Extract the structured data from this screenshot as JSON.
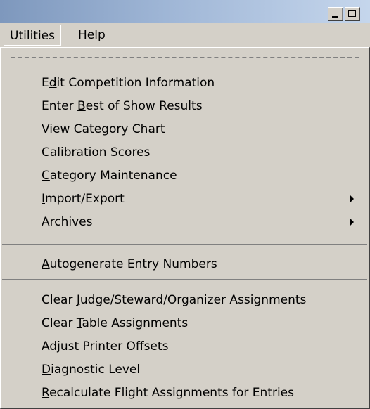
{
  "menubar": {
    "items": [
      {
        "label": "Utilities",
        "accel_index": 0
      },
      {
        "label": "Help",
        "accel_index": 0
      }
    ]
  },
  "menu": {
    "groups": [
      [
        {
          "label": "Edit Competition Information",
          "accel_index": 1,
          "submenu": false
        },
        {
          "label": "Enter Best of Show Results",
          "accel_index": 6,
          "submenu": false
        },
        {
          "label": "View Category Chart",
          "accel_index": 0,
          "submenu": false
        },
        {
          "label": "Calibration Scores",
          "accel_index": 3,
          "submenu": false
        },
        {
          "label": "Category Maintenance",
          "accel_index": 0,
          "submenu": false
        },
        {
          "label": "Import/Export",
          "accel_index": 0,
          "submenu": true
        },
        {
          "label": "Archives",
          "accel_index": -1,
          "submenu": true
        }
      ],
      [
        {
          "label": "Autogenerate Entry Numbers",
          "accel_index": 0,
          "submenu": false
        }
      ],
      [
        {
          "label": "Clear Judge/Steward/Organizer Assignments",
          "accel_index": 6,
          "submenu": false
        },
        {
          "label": "Clear Table Assignments",
          "accel_index": 6,
          "submenu": false
        },
        {
          "label": "Adjust Printer Offsets",
          "accel_index": 7,
          "submenu": false
        },
        {
          "label": "Diagnostic Level",
          "accel_index": 0,
          "submenu": false
        },
        {
          "label": "Recalculate Flight Assignments for Entries",
          "accel_index": 0,
          "submenu": false
        }
      ]
    ]
  }
}
